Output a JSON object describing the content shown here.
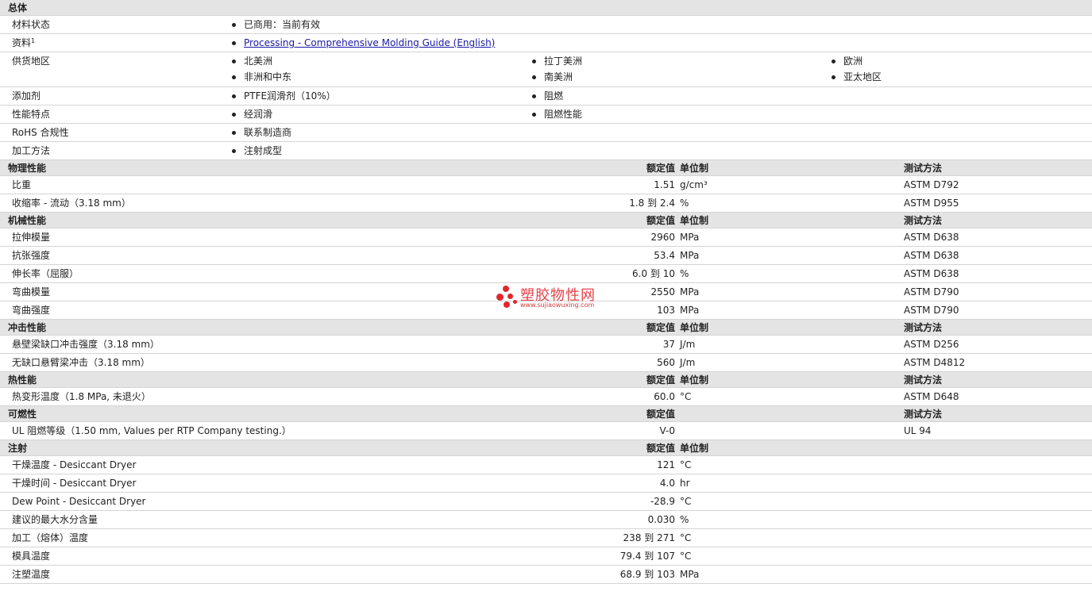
{
  "general": {
    "title": "总体",
    "rows": [
      {
        "label": "材料状态",
        "items": [
          "已商用：当前有效"
        ]
      },
      {
        "label": "资料",
        "sup": "1",
        "link": "Processing - Comprehensive Molding Guide (English)"
      },
      {
        "label": "供货地区",
        "items": [
          "北美洲",
          "拉丁美洲",
          "欧洲",
          "非洲和中东",
          "南美洲",
          "亚太地区"
        ]
      },
      {
        "label": "添加剂",
        "items": [
          "PTFE润滑剂（10%）",
          "阻燃"
        ]
      },
      {
        "label": "性能特点",
        "items": [
          "经润滑",
          "阻燃性能"
        ]
      },
      {
        "label": "RoHS 合规性",
        "items": [
          "联系制造商"
        ]
      },
      {
        "label": "加工方法",
        "items": [
          "注射成型"
        ]
      }
    ]
  },
  "col_headers": {
    "nominal": "额定值",
    "unit": "单位制",
    "test": "测试方法"
  },
  "physical": {
    "title": "物理性能",
    "rows": [
      {
        "label": "比重",
        "value": "1.51",
        "unit": "g/cm³",
        "test": "ASTM D792"
      },
      {
        "label": "收缩率 - 流动（3.18 mm）",
        "value": "1.8 到  2.4",
        "unit": "%",
        "test": "ASTM D955"
      }
    ]
  },
  "mechanical": {
    "title": "机械性能",
    "rows": [
      {
        "label": "拉伸模量",
        "value": "2960",
        "unit": "MPa",
        "test": "ASTM D638"
      },
      {
        "label": "抗张强度",
        "value": "53.4",
        "unit": "MPa",
        "test": "ASTM D638"
      },
      {
        "label": "伸长率（屈服）",
        "value": "6.0 到  10",
        "unit": "%",
        "test": "ASTM D638"
      },
      {
        "label": "弯曲模量",
        "value": "2550",
        "unit": "MPa",
        "test": "ASTM D790"
      },
      {
        "label": "弯曲强度",
        "value": "103",
        "unit": "MPa",
        "test": "ASTM D790"
      }
    ]
  },
  "impact": {
    "title": "冲击性能",
    "rows": [
      {
        "label": "悬壁梁缺口冲击强度（3.18 mm）",
        "value": "37",
        "unit": "J/m",
        "test": "ASTM D256"
      },
      {
        "label": "无缺口悬臂梁冲击（3.18 mm）",
        "value": "560",
        "unit": "J/m",
        "test": "ASTM D4812"
      }
    ]
  },
  "thermal": {
    "title": "热性能",
    "rows": [
      {
        "label": "热变形温度（1.8 MPa, 未退火）",
        "value": "60.0",
        "unit": "°C",
        "test": "ASTM D648"
      }
    ]
  },
  "flammability": {
    "title": "可燃性",
    "rows": [
      {
        "label": "UL 阻燃等级（1.50 mm, Values per RTP Company testing.）",
        "value": "V-0",
        "unit": "",
        "test": "UL 94"
      }
    ]
  },
  "injection": {
    "title": "注射",
    "rows": [
      {
        "label": "干燥温度 - Desiccant Dryer",
        "value": "121",
        "unit": "°C"
      },
      {
        "label": "干燥时间 - Desiccant Dryer",
        "value": "4.0",
        "unit": "hr"
      },
      {
        "label": "Dew Point - Desiccant Dryer",
        "value": "-28.9",
        "unit": "°C"
      },
      {
        "label": "建议的最大水分含量",
        "value": "0.030",
        "unit": "%"
      },
      {
        "label": "加工（熔体）温度",
        "value": "238 到  271",
        "unit": "°C"
      },
      {
        "label": "模具温度",
        "value": "79.4 到  107",
        "unit": "°C"
      },
      {
        "label": "注塑温度",
        "value": "68.9 到  103",
        "unit": "MPa"
      }
    ]
  },
  "watermark": {
    "name": "塑胶物性网",
    "url": "www.sujiaowuxing.com"
  }
}
